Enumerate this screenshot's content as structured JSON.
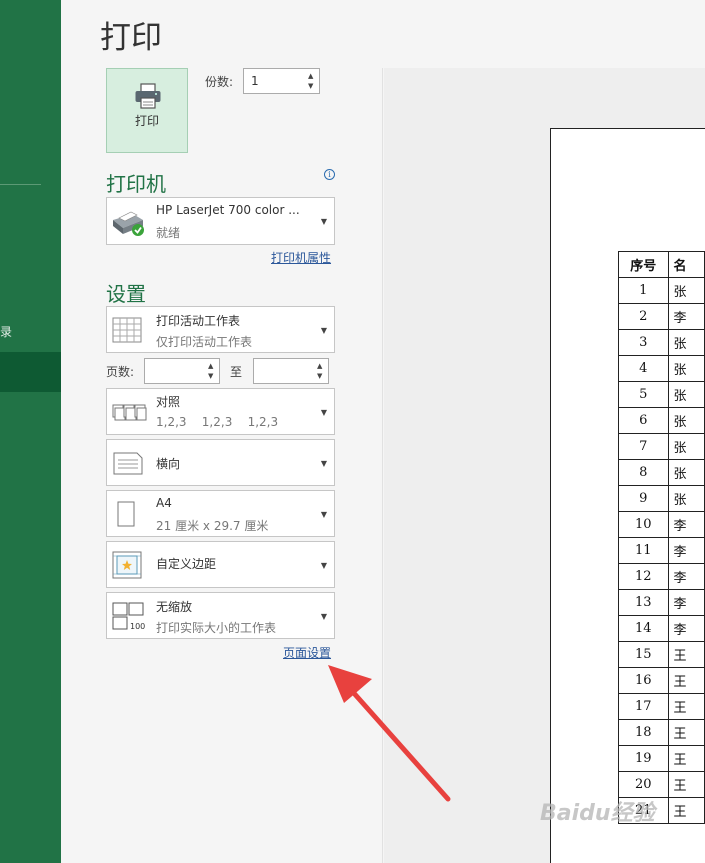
{
  "nav": {
    "partial_item": "录"
  },
  "page": {
    "title": "打印"
  },
  "print_button": {
    "label": "打印",
    "icon": "printer-icon"
  },
  "copies": {
    "label": "份数:",
    "value": "1"
  },
  "printer": {
    "section": "打印机",
    "name": "HP LaserJet 700 color ...",
    "status": "就绪",
    "properties_link": "打印机属性"
  },
  "settings": {
    "section": "设置",
    "scope": {
      "title": "打印活动工作表",
      "subtitle": "仅打印活动工作表"
    },
    "pages": {
      "label": "页数:",
      "to": "至",
      "from_value": "",
      "to_value": ""
    },
    "collate": {
      "title": "对照",
      "subtitle": "1,2,3    1,2,3    1,2,3"
    },
    "orientation": {
      "title": "横向"
    },
    "paper": {
      "title": "A4",
      "subtitle": "21 厘米 x 29.7 厘米"
    },
    "margins": {
      "title": "自定义边距"
    },
    "scaling": {
      "title": "无缩放",
      "subtitle": "打印实际大小的工作表"
    },
    "page_setup_link": "页面设置"
  },
  "preview": {
    "headers": [
      "序号",
      "名"
    ],
    "rows": [
      [
        "1",
        "张"
      ],
      [
        "2",
        "李"
      ],
      [
        "3",
        "张"
      ],
      [
        "4",
        "张"
      ],
      [
        "5",
        "张"
      ],
      [
        "6",
        "张"
      ],
      [
        "7",
        "张"
      ],
      [
        "8",
        "张"
      ],
      [
        "9",
        "张"
      ],
      [
        "10",
        "李"
      ],
      [
        "11",
        "李"
      ],
      [
        "12",
        "李"
      ],
      [
        "13",
        "李"
      ],
      [
        "14",
        "李"
      ],
      [
        "15",
        "王"
      ],
      [
        "16",
        "王"
      ],
      [
        "17",
        "王"
      ],
      [
        "18",
        "王"
      ],
      [
        "19",
        "王"
      ],
      [
        "20",
        "王"
      ],
      [
        "21",
        "王"
      ]
    ]
  },
  "watermark": "Baidu经验",
  "colors": {
    "accent": "#217346",
    "arrow": "#e8413e"
  }
}
